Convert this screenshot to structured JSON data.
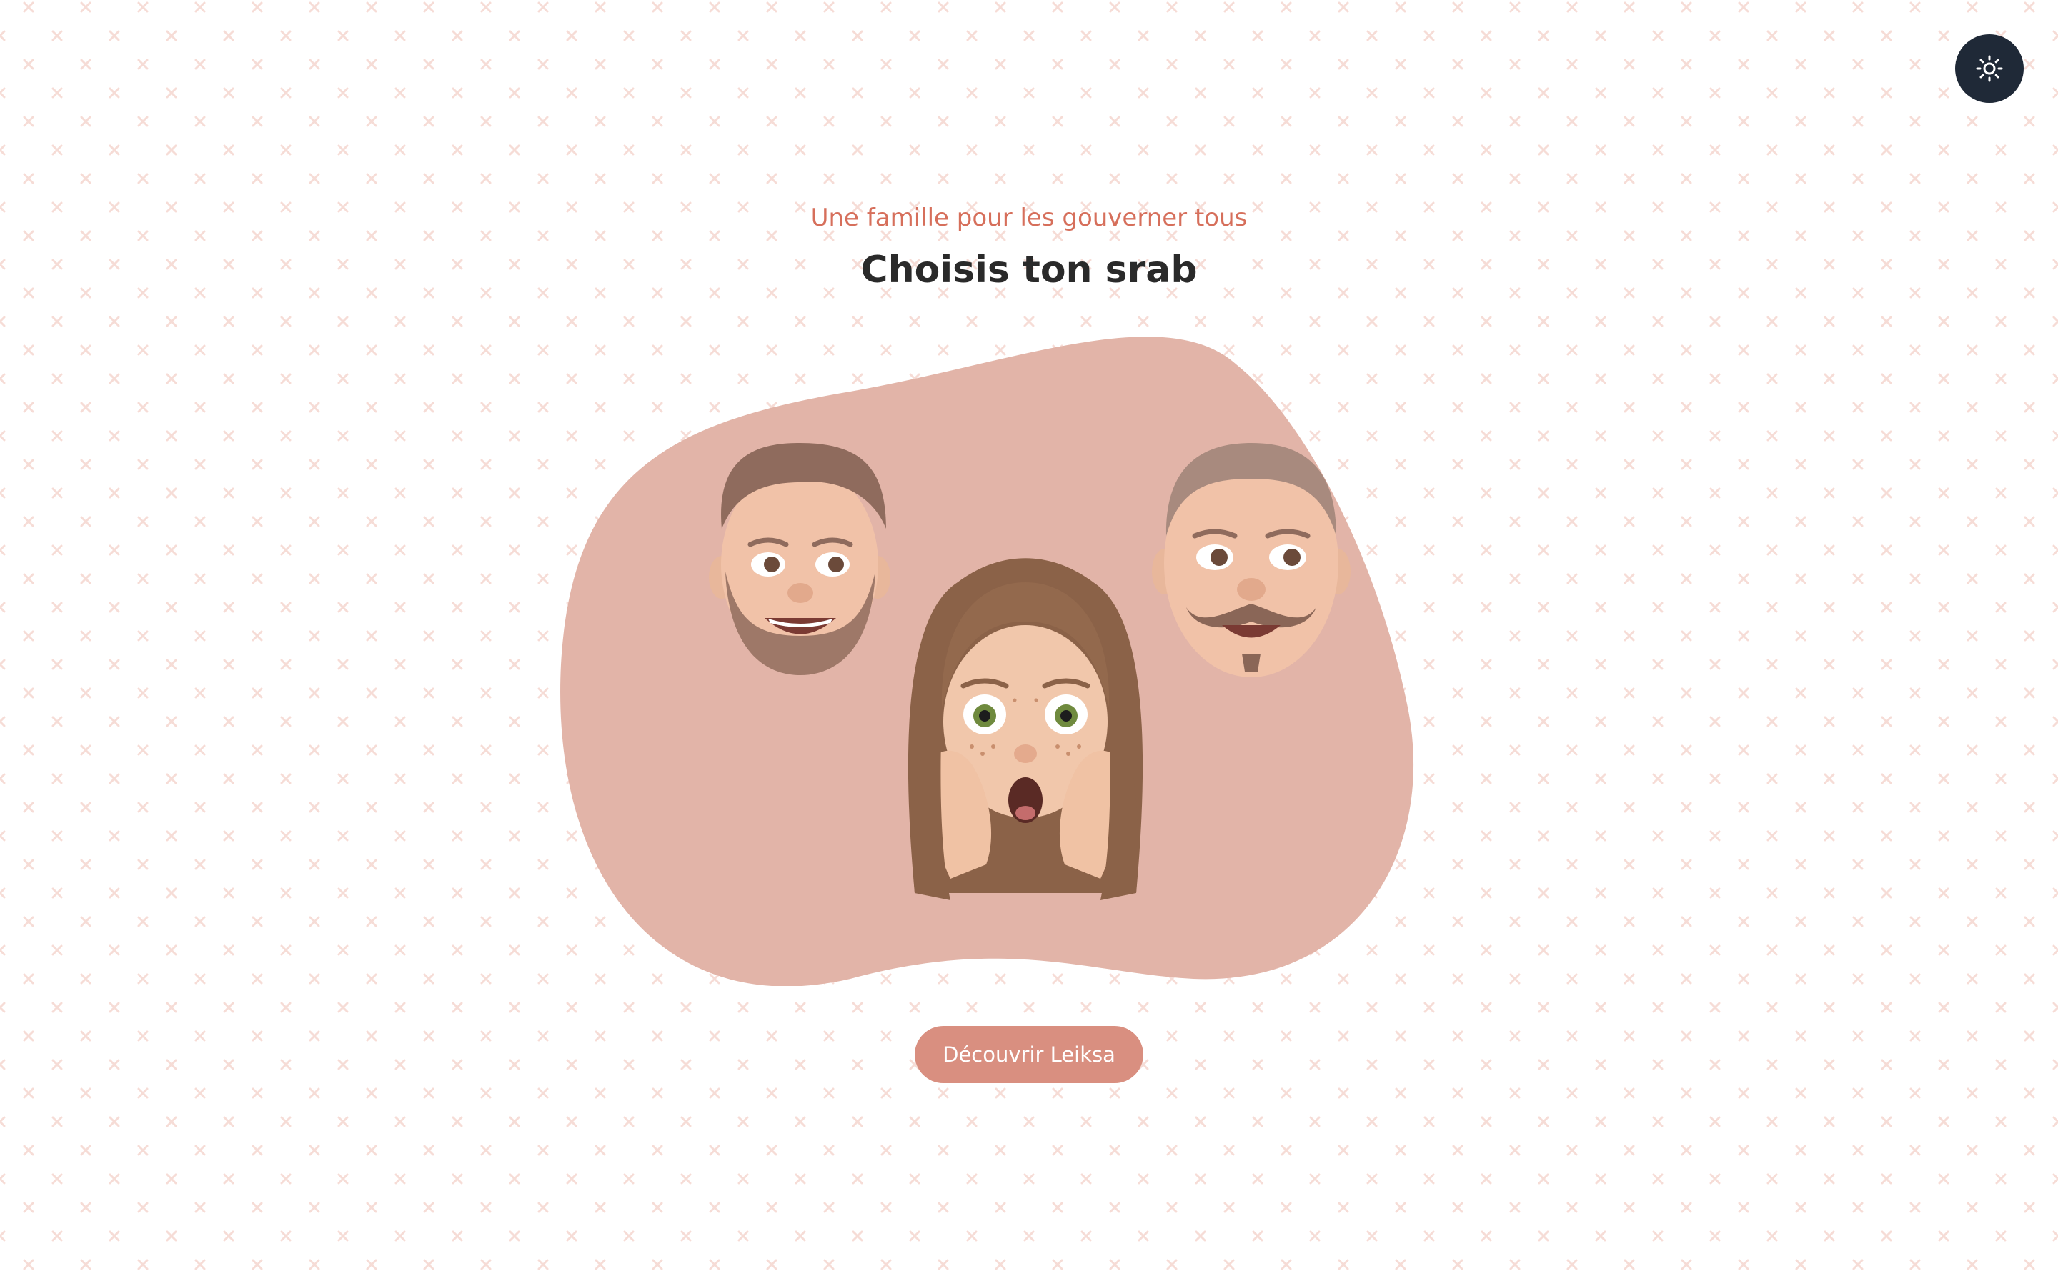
{
  "colors": {
    "accent": "#d98f80",
    "subtitle": "#d66f5b",
    "title": "#2a2a2a",
    "blob": "#e2b4a8",
    "pattern_mark": "#f6dcd6",
    "toggle_bg": "#1f2937"
  },
  "header": {
    "theme_toggle_icon": "sun-icon"
  },
  "hero": {
    "subtitle": "Une famille pour les gouverner tous",
    "title": "Choisis ton srab",
    "avatars": [
      {
        "name": "bearded-man-avatar"
      },
      {
        "name": "surprised-woman-avatar"
      },
      {
        "name": "mustache-man-avatar"
      }
    ]
  },
  "cta": {
    "label": "Découvrir Leiksa"
  }
}
